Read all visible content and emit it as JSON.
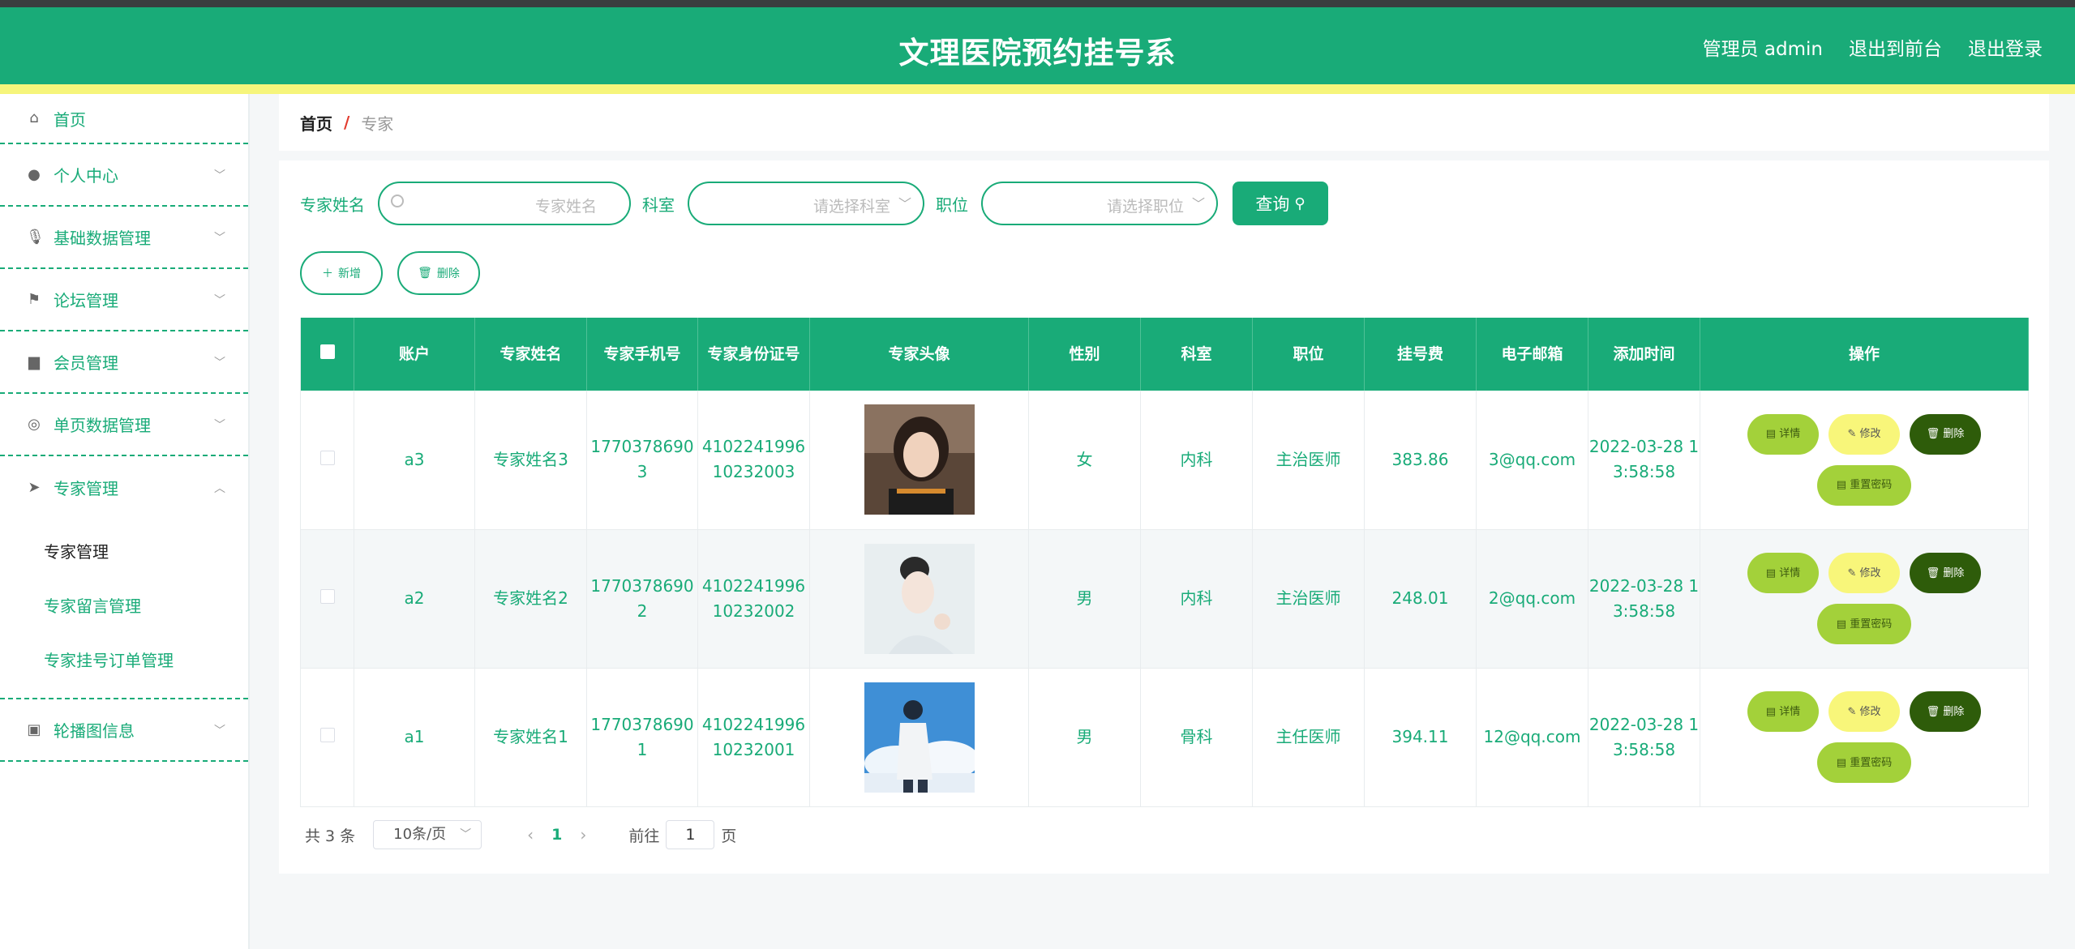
{
  "header": {
    "title": "文理医院预约挂号系",
    "nav": [
      "管理员 admin",
      "退出到前台",
      "退出登录"
    ]
  },
  "sidebar": {
    "home": {
      "label": "首页",
      "icon": "home-icon"
    },
    "items": [
      {
        "label": "个人中心",
        "icon": "user-icon"
      },
      {
        "label": "基础数据管理",
        "icon": "microphone-icon"
      },
      {
        "label": "论坛管理",
        "icon": "flag-icon"
      },
      {
        "label": "会员管理",
        "icon": "tray-icon"
      },
      {
        "label": "单页数据管理",
        "icon": "compass-icon"
      },
      {
        "label": "专家管理",
        "icon": "send-icon"
      }
    ],
    "submenu": [
      "专家管理",
      "专家留言管理",
      "专家挂号订单管理"
    ],
    "last": {
      "label": "轮播图信息",
      "icon": "clipboard-icon"
    }
  },
  "breadcrumb": {
    "home": "首页",
    "sep": "/",
    "current": "专家"
  },
  "search": {
    "name_label": "专家姓名",
    "name_placeholder": "专家姓名",
    "dept_label": "科室",
    "dept_placeholder": "请选择科室",
    "pos_label": "职位",
    "pos_placeholder": "请选择职位",
    "query_label": "查询"
  },
  "actions": {
    "add": "新增",
    "delete": "删除"
  },
  "table": {
    "columns": [
      "账户",
      "专家姓名",
      "专家手机号",
      "专家身份证号",
      "专家头像",
      "性别",
      "科室",
      "职位",
      "挂号费",
      "电子邮箱",
      "添加时间",
      "操作"
    ],
    "rows": [
      {
        "account": "a3",
        "name": "专家姓名3",
        "phone": "17703786903",
        "idcard": "410224199610232003",
        "gender": "女",
        "dept": "内科",
        "position": "主治医师",
        "fee": "383.86",
        "email": "3@qq.com",
        "time": "2022-03-28 13:58:58"
      },
      {
        "account": "a2",
        "name": "专家姓名2",
        "phone": "17703786902",
        "idcard": "410224199610232002",
        "gender": "男",
        "dept": "内科",
        "position": "主治医师",
        "fee": "248.01",
        "email": "2@qq.com",
        "time": "2022-03-28 13:58:58"
      },
      {
        "account": "a1",
        "name": "专家姓名1",
        "phone": "17703786901",
        "idcard": "410224199610232001",
        "gender": "男",
        "dept": "骨科",
        "position": "主任医师",
        "fee": "394.11",
        "email": "12@qq.com",
        "time": "2022-03-28 13:58:58"
      }
    ],
    "ops": {
      "detail": "详情",
      "edit": "修改",
      "del": "删除",
      "reset": "重置密码"
    }
  },
  "pager": {
    "total": "共 3 条",
    "size": "10条/页",
    "page": "1",
    "goto": "前往",
    "goto_value": "1",
    "unit": "页"
  },
  "colors": {
    "primary": "#19ab78",
    "accent_yellow": "#f6f57b",
    "lime": "#a3d13a",
    "dark_green": "#2e5c0a"
  }
}
